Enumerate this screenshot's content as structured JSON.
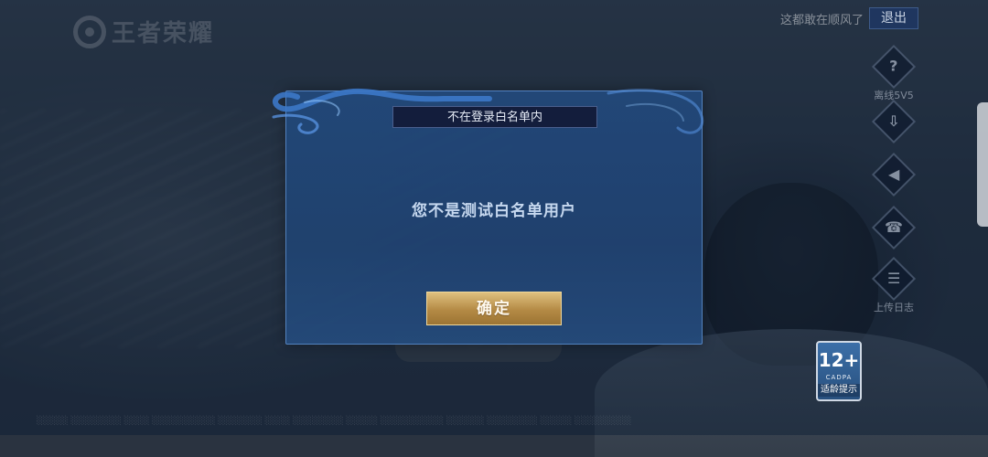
{
  "app": {
    "logo_text": "王者荣耀"
  },
  "header": {
    "weather_text": "这都敢在顺风了",
    "logout_label": "退出"
  },
  "side_menu": {
    "items": [
      {
        "icon": "question-icon",
        "glyph": "?",
        "label": "离线5V5"
      },
      {
        "icon": "download-icon",
        "glyph": "⇩",
        "label": ""
      },
      {
        "icon": "speaker-icon",
        "glyph": "◀",
        "label": ""
      },
      {
        "icon": "phone-icon",
        "glyph": "☎",
        "label": ""
      },
      {
        "icon": "notes-icon",
        "glyph": "☰",
        "label": "上传日志"
      }
    ]
  },
  "dialog": {
    "title": "不在登录白名单内",
    "message": "您不是测试白名单用户",
    "confirm_label": "确定"
  },
  "age_rating": {
    "value": "12+",
    "org": "CADPA",
    "tip": "适龄提示"
  },
  "colors": {
    "dialog_bg": "#22487a",
    "title_bg": "#131d3c",
    "confirm_gold": "#c9a35e",
    "logout_bg": "#1e3764"
  }
}
